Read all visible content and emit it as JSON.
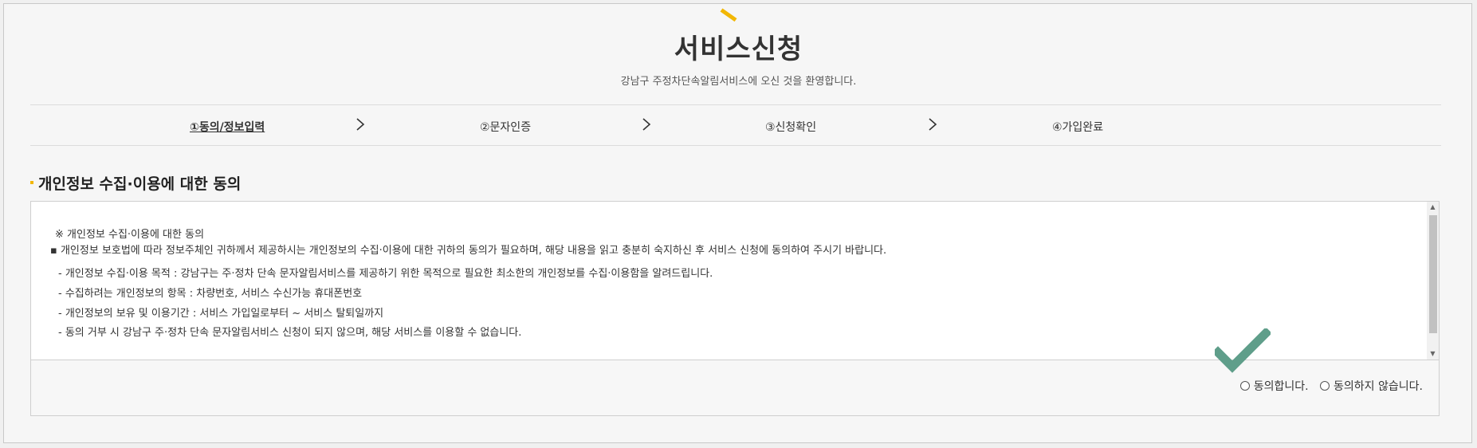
{
  "header": {
    "title": "서비스신청",
    "subtitle": "강남구 주정차단속알림서비스에 오신 것을 환영합니다."
  },
  "steps": [
    {
      "label": "①동의/정보입력",
      "active": true
    },
    {
      "label": "②문자인증",
      "active": false
    },
    {
      "label": "③신청확인",
      "active": false
    },
    {
      "label": "④가입완료",
      "active": false
    }
  ],
  "section": {
    "title": "개인정보 수집·이용에 대한 동의"
  },
  "consent": {
    "heading": "※ 개인정보 수집·이용에 대한 동의",
    "intro": "▪ 개인정보 보호법에 따라 정보주체인 귀하께서 제공하시는 개인정보의 수집·이용에 대한 귀하의 동의가 필요하며, 해당 내용을 읽고 충분히 숙지하신 후 서비스 신청에 동의하여 주시기 바랍니다.",
    "items": [
      "- 개인정보 수집·이용 목적 : 강남구는 주·정차 단속 문자알림서비스를 제공하기 위한 목적으로 필요한 최소한의 개인정보를 수집·이용함을 알려드립니다.",
      "- 수집하려는 개인정보의 항목 : 차량번호, 서비스 수신가능 휴대폰번호",
      "- 개인정보의 보유 및 이용기간 : 서비스 가입일로부터 ~ 서비스 탈퇴일까지",
      "- 동의 거부 시 강남구 주·정차 단속 문자알림서비스 신청이 되지 않으며, 해당 서비스를 이용할 수 없습니다."
    ]
  },
  "agreement": {
    "agree_label": "동의합니다.",
    "disagree_label": "동의하지 않습니다."
  },
  "icons": {
    "step_arrow": "chevron-right-icon",
    "check": "check-icon",
    "scroll_up": "scroll-up-arrow-icon",
    "scroll_down": "scroll-down-arrow-icon"
  },
  "colors": {
    "accent": "#f2b705",
    "check": "#5f9e8a"
  }
}
